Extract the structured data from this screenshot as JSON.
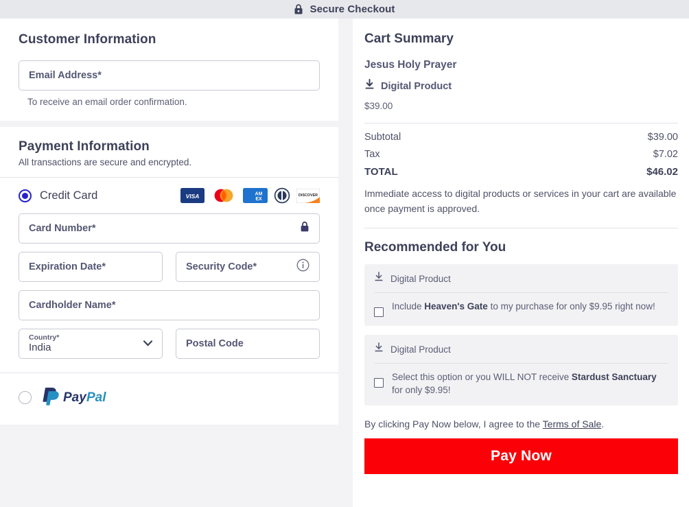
{
  "header": {
    "title": "Secure Checkout",
    "lock_icon": "lock-icon"
  },
  "customer": {
    "title": "Customer Information",
    "email_placeholder": "Email Address*",
    "helper": "To receive an email order confirmation."
  },
  "payment": {
    "title": "Payment Information",
    "subtitle": "All transactions are secure and encrypted.",
    "methods": [
      {
        "label": "Credit Card",
        "selected": true
      },
      {
        "label": "PayPal",
        "selected": false
      }
    ],
    "brands": [
      "visa-logo",
      "mastercard-logo",
      "amex-logo",
      "diners-club-logo",
      "discover-logo"
    ],
    "fields": {
      "card_number": "Card Number*",
      "card_number_icon": "lock-icon",
      "expiration": "Expiration Date*",
      "security_code": "Security Code*",
      "security_code_icon": "info-icon",
      "cardholder": "Cardholder Name*",
      "country_label": "Country*",
      "country_value": "India",
      "country_icon": "chevron-down-icon",
      "postal_code": "Postal Code"
    }
  },
  "cart": {
    "title": "Cart Summary",
    "item": {
      "name": "Jesus Holy Prayer",
      "type": "Digital Product",
      "type_icon": "download-icon",
      "price": "$39.00"
    },
    "totals": [
      {
        "label": "Subtotal",
        "value": "$39.00"
      },
      {
        "label": "Tax",
        "value": "$7.02"
      },
      {
        "label": "TOTAL",
        "value": "$46.02"
      }
    ],
    "note": "Immediate access to digital products or services in your cart are available once payment is approved."
  },
  "recommended": {
    "title": "Recommended for You",
    "offers": [
      {
        "type": "Digital Product",
        "type_icon": "download-icon",
        "text_before": "Include ",
        "product": "Heaven's Gate",
        "text_after": " to my purchase for only $9.95 right now!",
        "checked": false
      },
      {
        "type": "Digital Product",
        "type_icon": "download-icon",
        "text_before": "Select this option or you WILL NOT receive ",
        "product": "Stardust Sanctuary",
        "text_after": " for only $9.95!",
        "checked": false
      }
    ]
  },
  "footer": {
    "terms_before": "By clicking Pay Now below, I agree to the ",
    "terms_link": "Terms of Sale",
    "terms_after": ".",
    "pay_button": "Pay Now"
  },
  "colors": {
    "accent_blue": "#2a22c8",
    "pay_red": "#fb0007",
    "text_dark": "#3d4159",
    "panel_gray": "#f2f2f4",
    "bar_gray": "#e7e8ec"
  }
}
